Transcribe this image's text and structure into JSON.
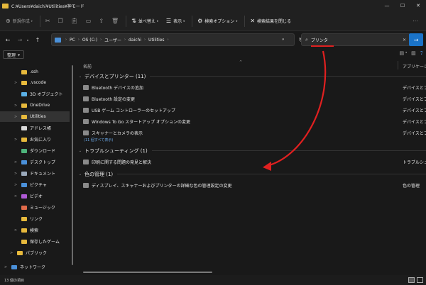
{
  "window": {
    "title": "C:¥Users¥daichi¥Utilities¥神モード",
    "controls": [
      "—",
      "☐",
      "✕"
    ]
  },
  "toolbar": {
    "new_label": "新規作成",
    "new_icon": "plus-circle-icon",
    "sort_label": "並べ替え",
    "view_label": "表示",
    "search_options_label": "検索オプション",
    "close_search_label": "検索結果を閉じる"
  },
  "address": {
    "crumbs": [
      "PC",
      "OS (C:)",
      "ユーザー",
      "daichi",
      "Utilities"
    ]
  },
  "search": {
    "value": "プリンタ"
  },
  "organize": {
    "label": "整理"
  },
  "nav": {
    "items": [
      {
        "label": ".ssh",
        "color": "#e7b93c",
        "chev": ""
      },
      {
        "label": ".vscode",
        "color": "#e7b93c",
        "chev": ">"
      },
      {
        "label": "3D オブジェクト",
        "color": "#5ab0e6",
        "chev": ""
      },
      {
        "label": "OneDrive",
        "color": "#e7b93c",
        "chev": ">"
      },
      {
        "label": "Utilities",
        "color": "#e7b93c",
        "chev": ">"
      },
      {
        "label": "アドレス帳",
        "color": "#d9d9d9",
        "chev": ""
      },
      {
        "label": "お気に入り",
        "color": "#e7b93c",
        "chev": ">"
      },
      {
        "label": "ダウンロード",
        "color": "#4db37a",
        "chev": ""
      },
      {
        "label": "デスクトップ",
        "color": "#4a90d9",
        "chev": ">"
      },
      {
        "label": "ドキュメント",
        "color": "#9aa9bb",
        "chev": ">"
      },
      {
        "label": "ピクチャ",
        "color": "#4a90d9",
        "chev": ">"
      },
      {
        "label": "ビデオ",
        "color": "#b05ad6",
        "chev": ">"
      },
      {
        "label": "ミュージック",
        "color": "#e06a4a",
        "chev": ""
      },
      {
        "label": "リンク",
        "color": "#e7b93c",
        "chev": ""
      },
      {
        "label": "検索",
        "color": "#e7b93c",
        "chev": ">"
      },
      {
        "label": "保存したゲーム",
        "color": "#e7b93c",
        "chev": ""
      },
      {
        "label": "パブリック",
        "color": "#e7b93c",
        "chev": ">"
      },
      {
        "label": "ネットワーク",
        "color": "#4a90d9",
        "chev": ">"
      }
    ]
  },
  "columns": {
    "name": "名前",
    "type": "アプリケーション"
  },
  "groups": [
    {
      "label": "デバイスとプリンター (11)",
      "items": [
        {
          "name": "Bluetooth デバイスの追加",
          "type": "デバイスとプ"
        },
        {
          "name": "Bluetooth 設定の変更",
          "type": "デバイスとプ"
        },
        {
          "name": "USB ゲーム コントローラーのセットアップ",
          "type": "デバイスとプ"
        },
        {
          "name": "Windows To Go スタートアップ オプションの変更",
          "type": "デバイスとプ"
        },
        {
          "name": "スキャナーとカメラの表示",
          "type": "デバイスとプ"
        }
      ],
      "more": "(11 個すべて表示)"
    },
    {
      "label": "トラブルシューティング (1)",
      "items": [
        {
          "name": "印刷に関する問題の発見と解決",
          "type": "トラブルシュー"
        }
      ]
    },
    {
      "label": "色の管理 (1)",
      "items": [
        {
          "name": "ディスプレイ、スキャナーおよびプリンターの詳細な色の管理設定の変更",
          "type": "色の管理"
        }
      ]
    }
  ],
  "status": {
    "count": "13 個の項目"
  },
  "colors": {
    "accent": "#1a73c8",
    "annotation": "#e02020"
  }
}
